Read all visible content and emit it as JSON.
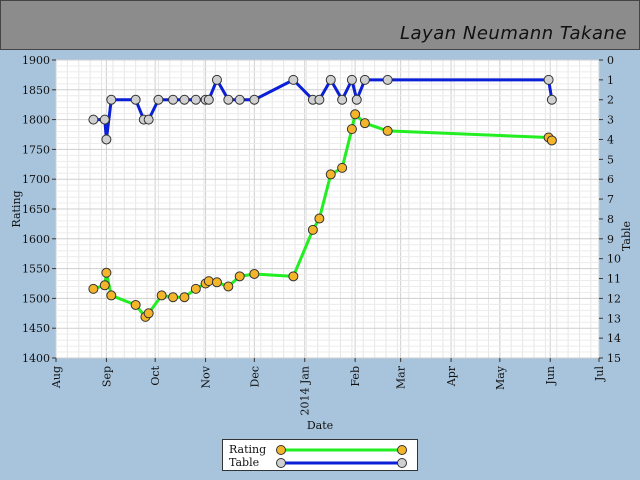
{
  "header": {
    "player_name": "Layan Neumann Takane"
  },
  "chart_data": {
    "type": "line",
    "xlabel": "Date",
    "ylabel": "Rating",
    "ylabel_right": "Table",
    "ylim": [
      1400,
      1900
    ],
    "y_ticks": [
      1400,
      1450,
      1500,
      1550,
      1600,
      1650,
      1700,
      1750,
      1800,
      1850,
      1900
    ],
    "y2lim": [
      0,
      15
    ],
    "y2_inverted": true,
    "y2_ticks": [
      0,
      1,
      2,
      3,
      4,
      5,
      6,
      7,
      8,
      9,
      10,
      11,
      12,
      13,
      14,
      15
    ],
    "xlim": [
      "2013-08-01",
      "2014-07-01"
    ],
    "x_ticks": [
      {
        "date": "2013-08-01",
        "label": "Aug"
      },
      {
        "date": "2013-09-01",
        "label": "Sep"
      },
      {
        "date": "2013-10-01",
        "label": "Oct"
      },
      {
        "date": "2013-11-01",
        "label": "Nov"
      },
      {
        "date": "2013-12-01",
        "label": "Dec"
      },
      {
        "date": "2014-01-01",
        "label": "2014 Jan"
      },
      {
        "date": "2014-02-01",
        "label": "Feb"
      },
      {
        "date": "2014-03-01",
        "label": "Mar"
      },
      {
        "date": "2014-04-01",
        "label": "Apr"
      },
      {
        "date": "2014-05-01",
        "label": "May"
      },
      {
        "date": "2014-06-01",
        "label": "Jun"
      },
      {
        "date": "2014-07-01",
        "label": "Jul"
      }
    ],
    "grid": true,
    "legend_position": "bottom",
    "series": [
      {
        "name": "Rating",
        "axis": "left",
        "line_color": "#22ee22",
        "marker_color": "#f5b52a",
        "points": [
          {
            "x": "2013-08-24",
            "y": 1516
          },
          {
            "x": "2013-08-31",
            "y": 1522
          },
          {
            "x": "2013-09-01",
            "y": 1543
          },
          {
            "x": "2013-09-04",
            "y": 1505
          },
          {
            "x": "2013-09-19",
            "y": 1489
          },
          {
            "x": "2013-09-25",
            "y": 1469
          },
          {
            "x": "2013-09-27",
            "y": 1475
          },
          {
            "x": "2013-10-05",
            "y": 1505
          },
          {
            "x": "2013-10-12",
            "y": 1502
          },
          {
            "x": "2013-10-19",
            "y": 1502
          },
          {
            "x": "2013-10-26",
            "y": 1516
          },
          {
            "x": "2013-11-01",
            "y": 1525
          },
          {
            "x": "2013-11-03",
            "y": 1529
          },
          {
            "x": "2013-11-08",
            "y": 1527
          },
          {
            "x": "2013-11-15",
            "y": 1520
          },
          {
            "x": "2013-11-22",
            "y": 1537
          },
          {
            "x": "2013-12-01",
            "y": 1541
          },
          {
            "x": "2013-12-25",
            "y": 1537
          },
          {
            "x": "2014-01-06",
            "y": 1615
          },
          {
            "x": "2014-01-10",
            "y": 1634
          },
          {
            "x": "2014-01-17",
            "y": 1708
          },
          {
            "x": "2014-01-24",
            "y": 1719
          },
          {
            "x": "2014-01-30",
            "y": 1784
          },
          {
            "x": "2014-02-01",
            "y": 1809
          },
          {
            "x": "2014-02-07",
            "y": 1794
          },
          {
            "x": "2014-02-21",
            "y": 1781
          },
          {
            "x": "2014-05-31",
            "y": 1770
          },
          {
            "x": "2014-06-02",
            "y": 1765
          }
        ]
      },
      {
        "name": "Table",
        "axis": "right",
        "line_color": "#0a1fd6",
        "marker_color": "#d0d0d0",
        "points": [
          {
            "x": "2013-08-24",
            "y": 3
          },
          {
            "x": "2013-08-31",
            "y": 3
          },
          {
            "x": "2013-09-01",
            "y": 4
          },
          {
            "x": "2013-09-04",
            "y": 2
          },
          {
            "x": "2013-09-19",
            "y": 2
          },
          {
            "x": "2013-09-24",
            "y": 3
          },
          {
            "x": "2013-09-27",
            "y": 3
          },
          {
            "x": "2013-10-03",
            "y": 2
          },
          {
            "x": "2013-10-12",
            "y": 2
          },
          {
            "x": "2013-10-19",
            "y": 2
          },
          {
            "x": "2013-10-26",
            "y": 2
          },
          {
            "x": "2013-11-01",
            "y": 2
          },
          {
            "x": "2013-11-03",
            "y": 2
          },
          {
            "x": "2013-11-08",
            "y": 1
          },
          {
            "x": "2013-11-15",
            "y": 2
          },
          {
            "x": "2013-11-22",
            "y": 2
          },
          {
            "x": "2013-12-01",
            "y": 2
          },
          {
            "x": "2013-12-25",
            "y": 1
          },
          {
            "x": "2014-01-06",
            "y": 2
          },
          {
            "x": "2014-01-10",
            "y": 2
          },
          {
            "x": "2014-01-17",
            "y": 1
          },
          {
            "x": "2014-01-24",
            "y": 2
          },
          {
            "x": "2014-01-30",
            "y": 1
          },
          {
            "x": "2014-02-02",
            "y": 2
          },
          {
            "x": "2014-02-07",
            "y": 1
          },
          {
            "x": "2014-02-21",
            "y": 1
          },
          {
            "x": "2014-05-31",
            "y": 1
          },
          {
            "x": "2014-06-02",
            "y": 2
          }
        ]
      }
    ]
  },
  "legend": {
    "items": [
      {
        "label": "Rating"
      },
      {
        "label": "Table"
      }
    ]
  }
}
